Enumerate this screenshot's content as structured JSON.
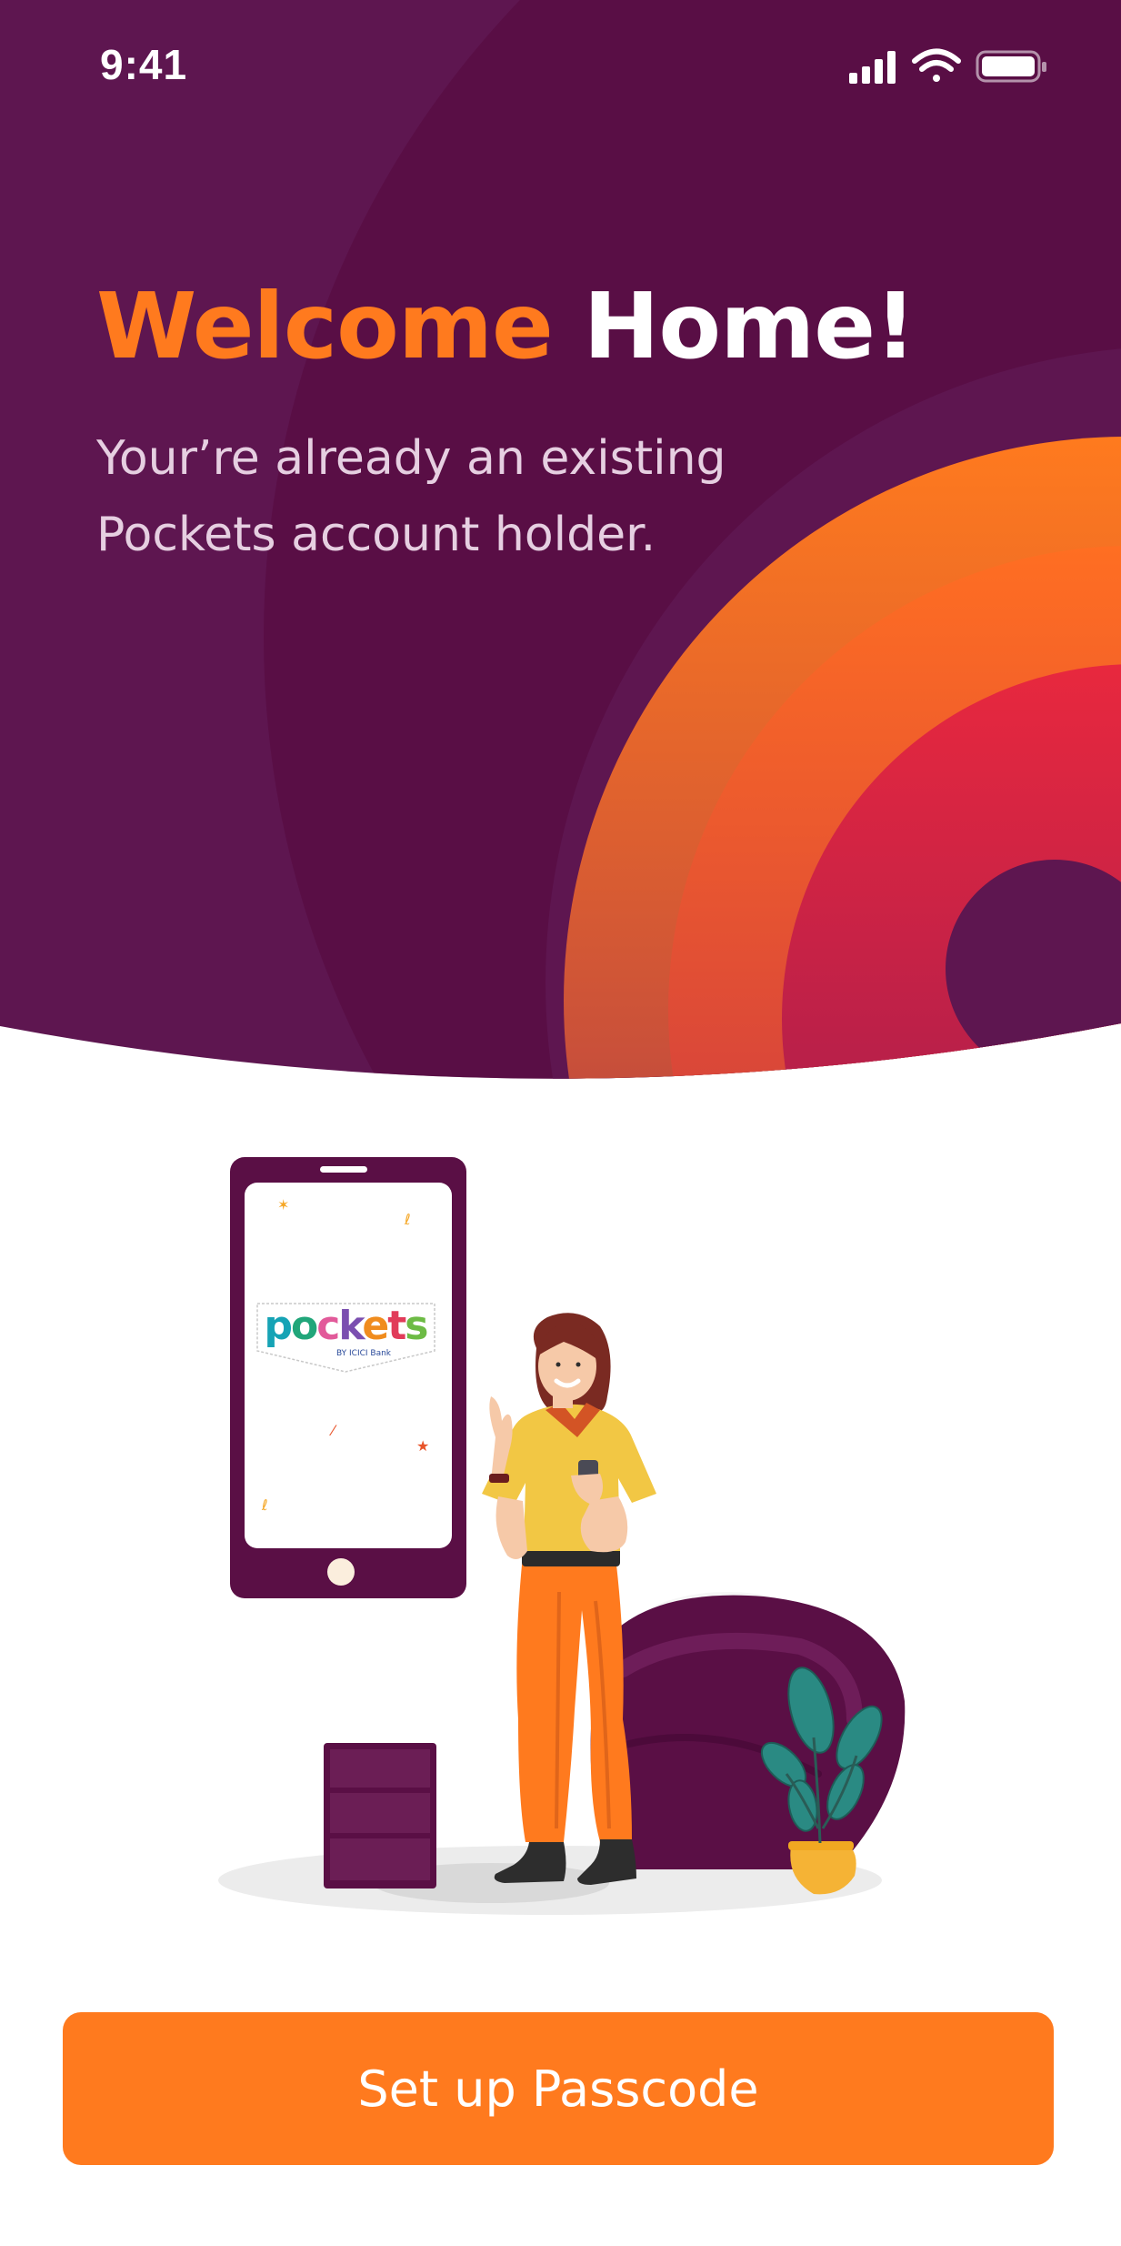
{
  "status_bar": {
    "time": "9:41",
    "icons": [
      "cellular-signal-icon",
      "wifi-icon",
      "battery-icon"
    ]
  },
  "header": {
    "title_part1": "Welcome",
    "title_part2": "Home!",
    "subtitle_line1": "Your’re already an existing",
    "subtitle_line2": "Pockets account holder."
  },
  "illustration": {
    "app_logo_text": "pockets",
    "app_logo_sub": "BY ICICI Bank"
  },
  "actions": {
    "primary_button": "Set up Passcode"
  },
  "colors": {
    "brand_purple": "#5e1650",
    "accent_orange": "#ff7a1e",
    "accent_red": "#e0283c"
  }
}
